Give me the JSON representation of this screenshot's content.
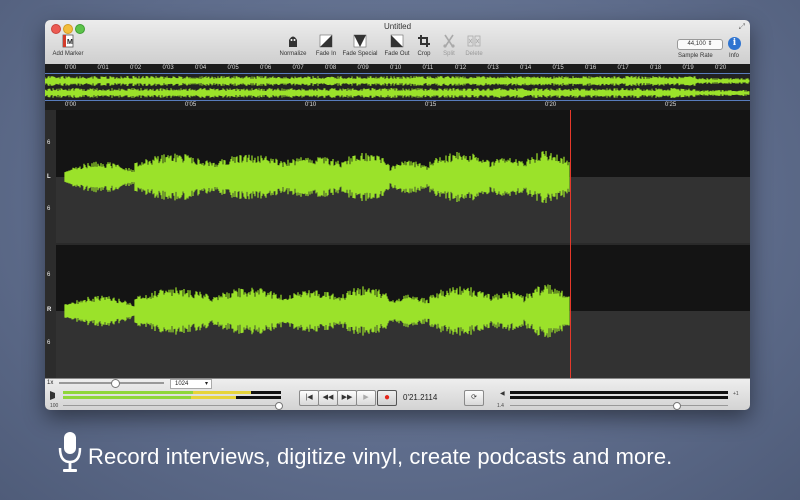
{
  "window": {
    "title": "Untitled"
  },
  "toolbar": {
    "add_marker": "Add Marker",
    "tools": [
      {
        "label": "Normalize",
        "icon": "normalize-icon",
        "enabled": true
      },
      {
        "label": "Fade In",
        "icon": "fade-in-icon",
        "enabled": true
      },
      {
        "label": "Fade Special",
        "icon": "fade-special-icon",
        "enabled": true
      },
      {
        "label": "Fade Out",
        "icon": "fade-out-icon",
        "enabled": true
      },
      {
        "label": "Crop",
        "icon": "crop-icon",
        "enabled": true
      },
      {
        "label": "Split",
        "icon": "split-icon",
        "enabled": false
      },
      {
        "label": "Delete",
        "icon": "delete-icon",
        "enabled": false
      }
    ],
    "sample_rate_value": "44,100",
    "sample_rate_label": "Sample Rate",
    "info_label": "Info",
    "info_glyph": "i"
  },
  "overview_ruler": [
    "0'00",
    "0'01",
    "0'02",
    "0'03",
    "0'04",
    "0'05",
    "0'06",
    "0'07",
    "0'08",
    "0'09",
    "0'10",
    "0'11",
    "0'12",
    "0'13",
    "0'14",
    "0'15",
    "0'16",
    "0'17",
    "0'18",
    "0'19",
    "0'20"
  ],
  "main_ruler": [
    "0'00",
    "0'05",
    "0'10",
    "0'15",
    "0'20",
    "0'25"
  ],
  "channels": {
    "left": {
      "label": "L",
      "scale_top": "6",
      "scale_bottom": "6"
    },
    "right": {
      "label": "R",
      "scale_top": "6",
      "scale_bottom": "6"
    }
  },
  "bottom": {
    "zoom_label": "1x",
    "zoom_select": "1024",
    "input_level_label": "100",
    "output_level_label": "1.4",
    "output_end_label": "+1",
    "timecode": "0'21.2114",
    "playhead_time": "0'21.2114"
  },
  "caption": "Record interviews, digitize vinyl, create podcasts and more.",
  "colors": {
    "waveform": "#9be22a",
    "playhead": "#e5392b",
    "accent": "#2f74d0"
  }
}
